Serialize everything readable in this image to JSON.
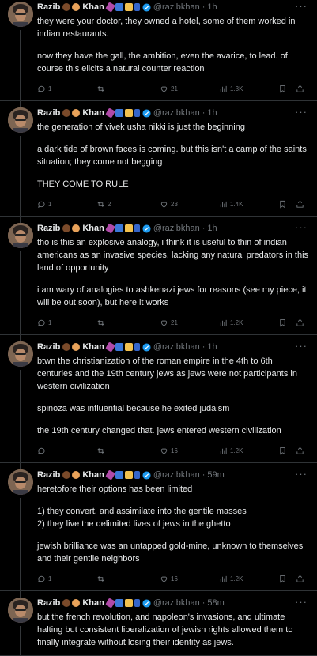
{
  "tweets": [
    {
      "name": "Razib",
      "handle": "@razibkhan",
      "time": "1h",
      "paragraphs": [
        "they were your doctor, they owned a hotel, some of them worked in indian restaurants.",
        "now they have the gall, the ambition, even the avarice, to lead. of course this elicits a natural counter reaction"
      ],
      "replies": "1",
      "retweets": "",
      "likes": "21",
      "views": "1.3K"
    },
    {
      "name": "Razib",
      "handle": "@razibkhan",
      "time": "1h",
      "paragraphs": [
        "the generation of vivek usha nikki is just the beginning",
        "a dark tide of brown faces is coming. but this isn't a camp of the saints situation; they come not begging",
        "THEY COME TO RULE"
      ],
      "replies": "1",
      "retweets": "2",
      "likes": "23",
      "views": "1.4K"
    },
    {
      "name": "Razib",
      "handle": "@razibkhan",
      "time": "1h",
      "paragraphs": [
        "tho is this an explosive analogy, i think it is useful to thin of indian americans as an invasive species, lacking any natural predators in this land of opportunity",
        "i am wary of analogies to ashkenazi jews for reasons (see my piece, it will be out soon), but here it works"
      ],
      "replies": "1",
      "retweets": "",
      "likes": "21",
      "views": "1.2K"
    },
    {
      "name": "Razib",
      "handle": "@razibkhan",
      "time": "1h",
      "paragraphs": [
        "btwn the christianization of the roman empire in the 4th to 6th centuries and the 19th century jews as jews were not participants in western civilization",
        "spinoza was influential because he exited judaism",
        "the 19th century changed that. jews entered western civilization"
      ],
      "replies": "",
      "retweets": "",
      "likes": "16",
      "views": "1.2K"
    },
    {
      "name": "Razib",
      "handle": "@razibkhan",
      "time": "59m",
      "paragraphs": [
        "heretofore their options has been limited",
        "1) they convert, and assimilate into the gentile masses\n2) they live the delimited lives of jews in the ghetto",
        "jewish brilliance was an untapped gold-mine, unknown to themselves and their gentile neighbors"
      ],
      "replies": "1",
      "retweets": "",
      "likes": "16",
      "views": "1.2K"
    },
    {
      "name": "Razib",
      "handle": "@razibkhan",
      "time": "58m",
      "paragraphs": [
        "but the french revolution, and napoleon's invasions, and ultimate halting but consistent liberalization of jewish rights allowed them to finally integrate without losing their identity as jews."
      ],
      "replies": "",
      "retweets": "",
      "likes": "",
      "views": ""
    }
  ],
  "first_name_suffix": "Khan",
  "colors": {
    "background": "#000000",
    "text": "#e7e9ea",
    "muted": "#71767b",
    "verified": "#1d9bf0",
    "divider": "#2f3336"
  }
}
